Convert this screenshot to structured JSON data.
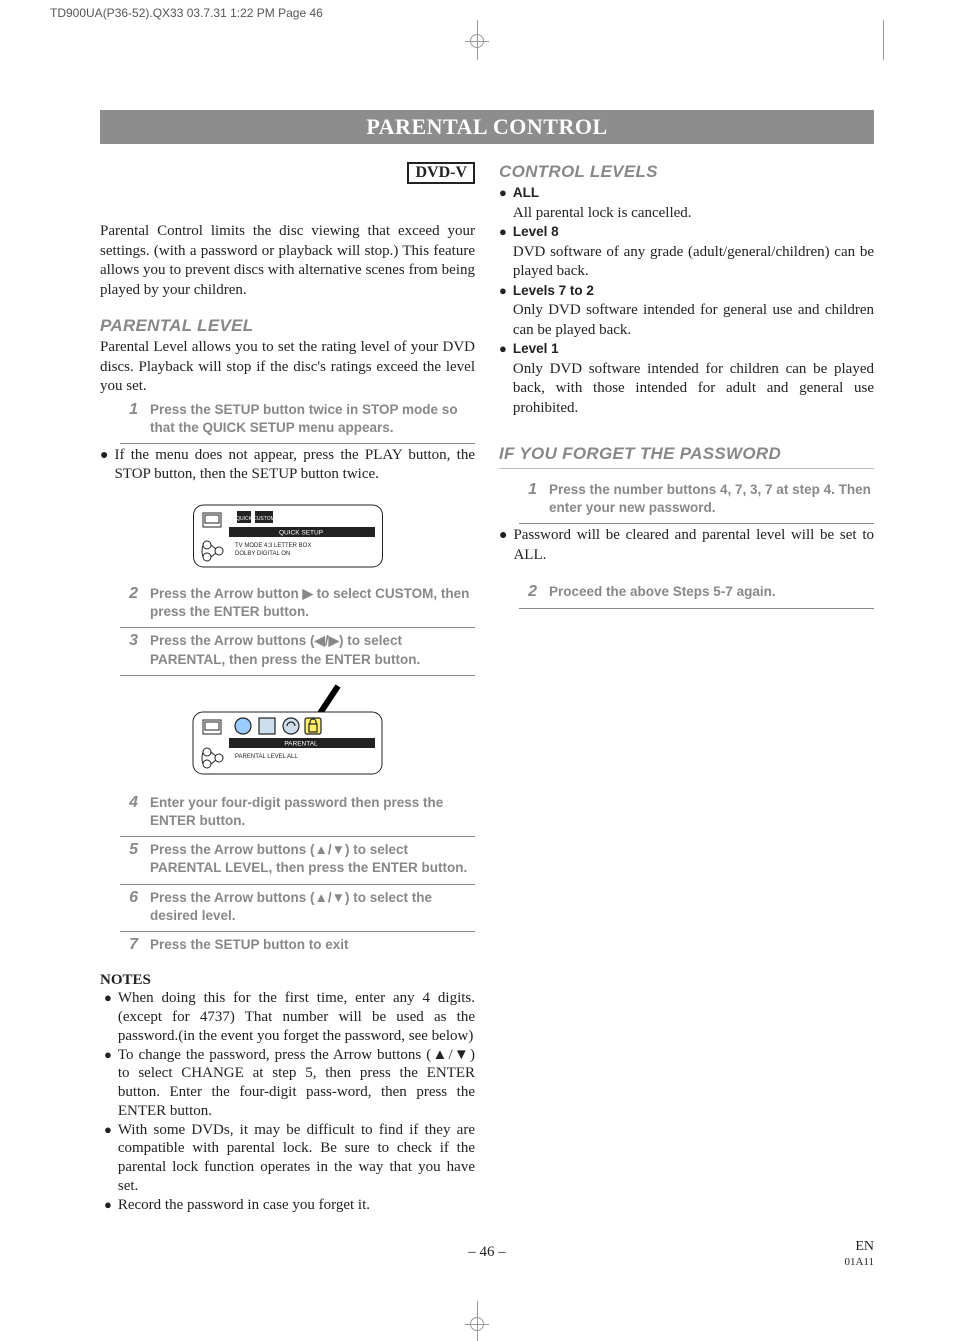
{
  "slug": "TD900UA(P36-52).QX33  03.7.31 1:22 PM  Page 46",
  "page_title": "PARENTAL CONTROL",
  "dvdv_badge": "DVD-V",
  "intro": "Parental Control limits the disc viewing that exceed your settings. (with a password or playback will stop.) This feature allows you to prevent discs with alternative scenes from being played by your children.",
  "left": {
    "h_parental_level": "PARENTAL LEVEL",
    "parental_level_body": "Parental Level allows you to set the rating level of your DVD discs. Playback will stop if the disc's ratings exceed the level you set.",
    "steps": {
      "s1": "Press the SETUP button twice in STOP mode so that the QUICK SETUP menu appears.",
      "s1_note": "If the menu does not appear, press the PLAY button, the STOP button, then the SETUP button twice.",
      "s2": "Press the Arrow button ▶ to select CUSTOM, then press the ENTER button.",
      "s3": "Press the Arrow buttons (◀/▶) to select PARENTAL, then press the ENTER button.",
      "s4": "Enter your four-digit password then press the ENTER button.",
      "s5": "Press the Arrow buttons (▲/▼) to select PARENTAL LEVEL, then press the ENTER button.",
      "s6": "Press the Arrow buttons (▲/▼) to select the desired level.",
      "s7": "Press the SETUP button to exit"
    },
    "diagram1": {
      "tab": "QUICK SETUP",
      "row1": "TV MODE            4:3 LETTER BOX",
      "row2": "DOLBY DIGITAL   ON"
    },
    "diagram2": {
      "tab": "PARENTAL",
      "row1": "PARENTAL LEVEL    ALL"
    },
    "notes_hd": "NOTES",
    "notes": {
      "n1": "When doing this for the first time, enter any 4 digits. (except for 4737) That number will be used as the password.(in the event you forget the password, see below)",
      "n2": "To change the password, press the Arrow buttons (▲/▼) to select CHANGE at step 5, then press the ENTER button. Enter the four-digit pass-word, then press the ENTER button.",
      "n3": "With some DVDs, it may be difficult to find if they are compatible with parental lock. Be sure to check if the parental lock function operates in the way that you have set.",
      "n4": "Record the password in case you forget it."
    }
  },
  "right": {
    "h_control_levels": "CONTROL LEVELS",
    "levels": {
      "all_h": "ALL",
      "all_b": "All parental lock is cancelled.",
      "l8_h": "Level 8",
      "l8_b": "DVD software of any grade (adult/general/children) can be played back.",
      "l72_h": "Levels 7 to 2",
      "l72_b": "Only DVD software intended for general use and children can be played back.",
      "l1_h": "Level 1",
      "l1_b": "Only DVD software intended for children can be played back, with those intended for adult and general use prohibited."
    },
    "h_forgot": "IF YOU FORGET THE PASSWORD",
    "forgot_steps": {
      "s1": "Press the number buttons 4, 7, 3, 7 at step 4. Then enter your new password.",
      "s1_note": "Password will be cleared and parental level will be set to ALL.",
      "s2": "Proceed the above Steps 5-7 again."
    }
  },
  "footer": {
    "page": "– 46 –",
    "lang": "EN",
    "code": "01A11"
  }
}
